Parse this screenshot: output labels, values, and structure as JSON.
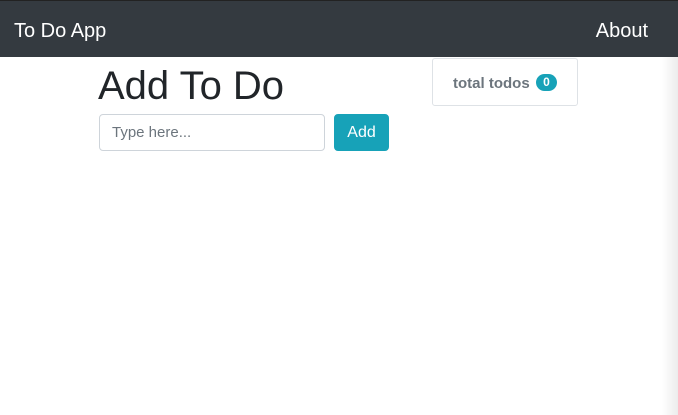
{
  "navbar": {
    "brand": "To Do App",
    "about_label": "About"
  },
  "main": {
    "title": "Add To Do",
    "input": {
      "value": "",
      "placeholder": "Type here..."
    },
    "add_label": "Add"
  },
  "counter": {
    "label": "total todos",
    "count": "0"
  },
  "colors": {
    "navbar_bg": "#343a40",
    "accent": "#17a2b8",
    "muted_text": "#6c757d"
  }
}
